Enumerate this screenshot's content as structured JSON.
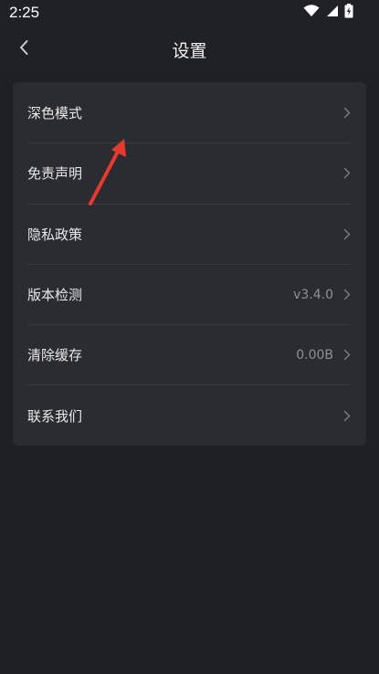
{
  "status_bar": {
    "time": "2:25"
  },
  "header": {
    "title": "设置",
    "back_icon": "chevron-left-icon"
  },
  "settings": {
    "items": [
      {
        "label": "深色模式",
        "value": ""
      },
      {
        "label": "免责声明",
        "value": ""
      },
      {
        "label": "隐私政策",
        "value": ""
      },
      {
        "label": "版本检测",
        "value": "v3.4.0"
      },
      {
        "label": "清除缓存",
        "value": "0.00B"
      },
      {
        "label": "联系我们",
        "value": ""
      }
    ]
  },
  "colors": {
    "background": "#1f2025",
    "card": "#2b2c31",
    "divider": "#3a3b41",
    "text_primary": "#e8e8e8",
    "text_secondary": "#8f9096",
    "annotation_arrow": "#e53a2d"
  },
  "icons": {
    "wifi": "wifi-icon",
    "signal": "signal-icon",
    "battery": "battery-icon",
    "chevron": "chevron-right-icon"
  }
}
